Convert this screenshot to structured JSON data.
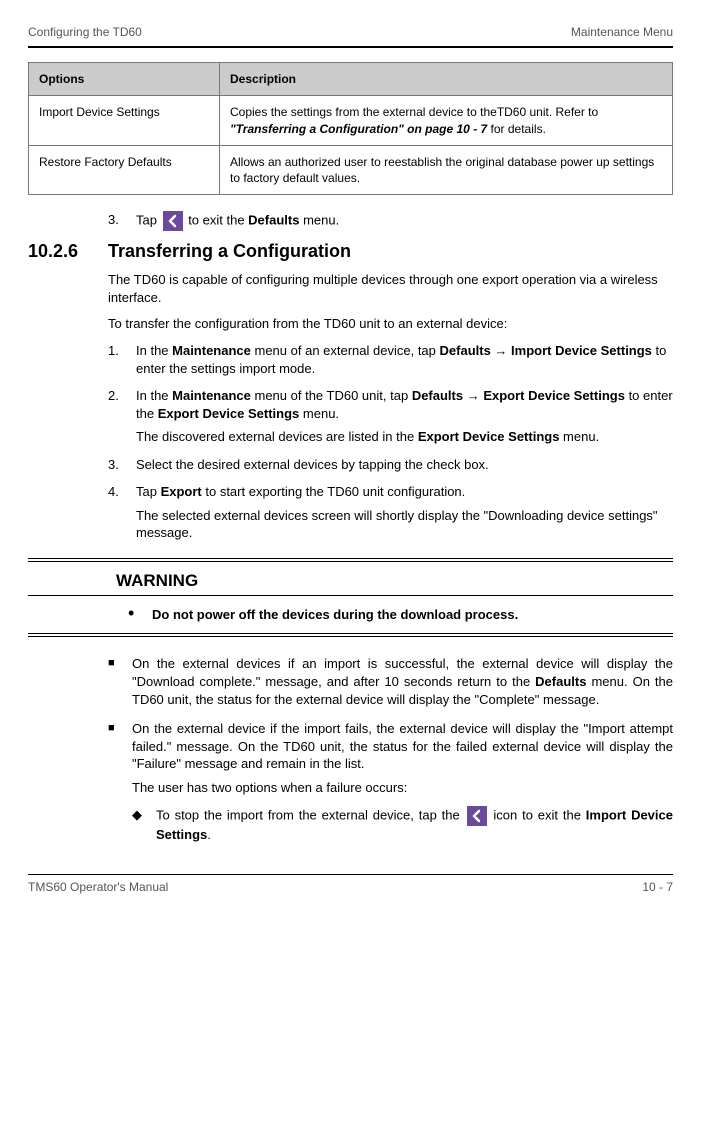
{
  "header": {
    "left": "Configuring the TD60",
    "right": "Maintenance Menu"
  },
  "table": {
    "head": {
      "c1": "Options",
      "c2": "Description"
    },
    "rows": [
      {
        "c1": "Import Device Settings",
        "c2_pre": "Copies the settings from the external device to theTD60 unit. Refer to ",
        "c2_em": "\"Transferring a Configuration\" on page 10 - 7",
        "c2_post": " for details."
      },
      {
        "c1": "Restore Factory Defaults",
        "c2": "Allows an authorized user to reestablish the original database power up settings to factory default values."
      }
    ]
  },
  "step3": {
    "n": "3.",
    "pre": "Tap ",
    "post": " to exit the ",
    "bold": "Defaults",
    "end": " menu."
  },
  "section": {
    "num": "10.2.6",
    "title": "Transferring a Configuration"
  },
  "para1": "The TD60 is capable of configuring multiple devices through one export operation via a wireless interface.",
  "para2": "To transfer the configuration from the TD60 unit to an external device:",
  "steps": [
    {
      "n": "1.",
      "pre": "In the ",
      "b1": "Maintenance",
      "mid1": " menu of an external device, tap ",
      "b2": "Defaults",
      "arrow": " → ",
      "b3": "Import Device Settings",
      "post": " to enter the settings import mode."
    },
    {
      "n": "2.",
      "pre": "In the ",
      "b1": "Maintenance",
      "mid1": " menu of the TD60 unit, tap ",
      "b2": "Defaults",
      "arrow": " → ",
      "b3": "Export Device Settings",
      "mid2": " to enter the ",
      "b4": "Export Device Settings",
      "post": " menu.",
      "sub_pre": "The discovered external devices are listed in the ",
      "sub_b": "Export Device Settings",
      "sub_post": " menu."
    },
    {
      "n": "3.",
      "text": "Select the desired external devices by tapping the check box."
    },
    {
      "n": "4.",
      "pre": "Tap ",
      "b1": "Export",
      "post": " to start exporting the TD60 unit configuration.",
      "sub": "The selected external devices screen will shortly display the \"Downloading device settings\" message."
    }
  ],
  "warning": {
    "title": "WARNING",
    "text": "Do not power off the devices during the download process."
  },
  "squares": [
    {
      "pre": "On the external devices if an import is successful, the external device will display the \"Download complete.\" message, and after 10 seconds return to the ",
      "b": "Defaults",
      "post": " menu. On the TD60 unit, the status for the external device will display the \"Complete\" message."
    },
    {
      "text": "On the external device if the import fails, the external device will display the \"Import attempt failed.\" message. On the TD60 unit, the status for the failed external device will display the \"Failure\" message and remain in the list.",
      "sub": "The user has two options when a failure occurs:"
    }
  ],
  "diamond": {
    "pre": "To stop the import from the external device, tap the ",
    "mid": " icon to exit the ",
    "b": "Import Device Settings",
    "post": "."
  },
  "footer": {
    "left": "TMS60 Operator's Manual",
    "right": "10 - 7"
  }
}
